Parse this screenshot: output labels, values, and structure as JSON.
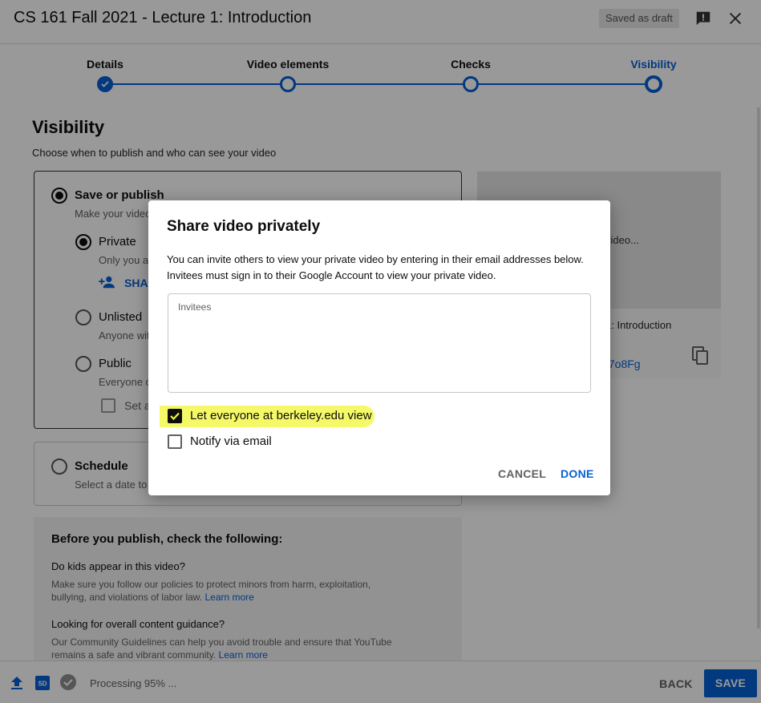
{
  "header": {
    "title": "CS 161 Fall 2021 - Lecture 1: Introduction",
    "draft_badge": "Saved as draft",
    "feedback_icon": "feedback-icon",
    "close_icon": "close-icon"
  },
  "steps": [
    {
      "label": "Details",
      "state": "done"
    },
    {
      "label": "Video elements",
      "state": "pending"
    },
    {
      "label": "Checks",
      "state": "pending"
    },
    {
      "label": "Visibility",
      "state": "current"
    }
  ],
  "visibility": {
    "title": "Visibility",
    "subtitle": "Choose when to publish and who can see your video",
    "save_publish": {
      "label": "Save or publish",
      "sub": "Make your video",
      "selected": true
    },
    "private": {
      "label": "Private",
      "sub": "Only you a",
      "selected": true
    },
    "share_link": "SHA",
    "unlisted": {
      "label": "Unlisted",
      "sub": "Anyone wit"
    },
    "public": {
      "label": "Public",
      "sub": "Everyone c"
    },
    "set_premiere": "Set a",
    "schedule": {
      "label": "Schedule",
      "sub": "Select a date to"
    }
  },
  "preview": {
    "thumb_text": "video...",
    "video_title": "1: Introduction",
    "video_link": "t7o8Fg",
    "copy_icon": "copy-icon"
  },
  "checklist": {
    "title": "Before you publish, check the following:",
    "q1": "Do kids appear in this video?",
    "a1": "Make sure you follow our policies to protect minors from harm, exploitation, bullying, and violations of labor law.",
    "a1_link": "Learn more",
    "q2": "Looking for overall content guidance?",
    "a2": "Our Community Guidelines can help you avoid trouble and ensure that YouTube remains a safe and vibrant community.",
    "a2_link": "Learn more"
  },
  "footer": {
    "processing": "Processing 95% ...",
    "back": "BACK",
    "save": "SAVE"
  },
  "dialog": {
    "title": "Share video privately",
    "body_line1": "You can invite others to view your private video by entering in their email addresses below.",
    "body_line2": "Invitees must sign in to their Google Account to view your private video.",
    "invitees_placeholder": "Invitees",
    "domain_checkbox": {
      "label": "Let everyone at berkeley.edu view",
      "checked": true
    },
    "notify_checkbox": {
      "label": "Notify via email",
      "checked": false
    },
    "cancel": "CANCEL",
    "done": "DONE",
    "highlight_color": "#f1f736"
  },
  "colors": {
    "accent": "#065fd4",
    "scrim": "rgba(0,0,0,0.40)"
  }
}
